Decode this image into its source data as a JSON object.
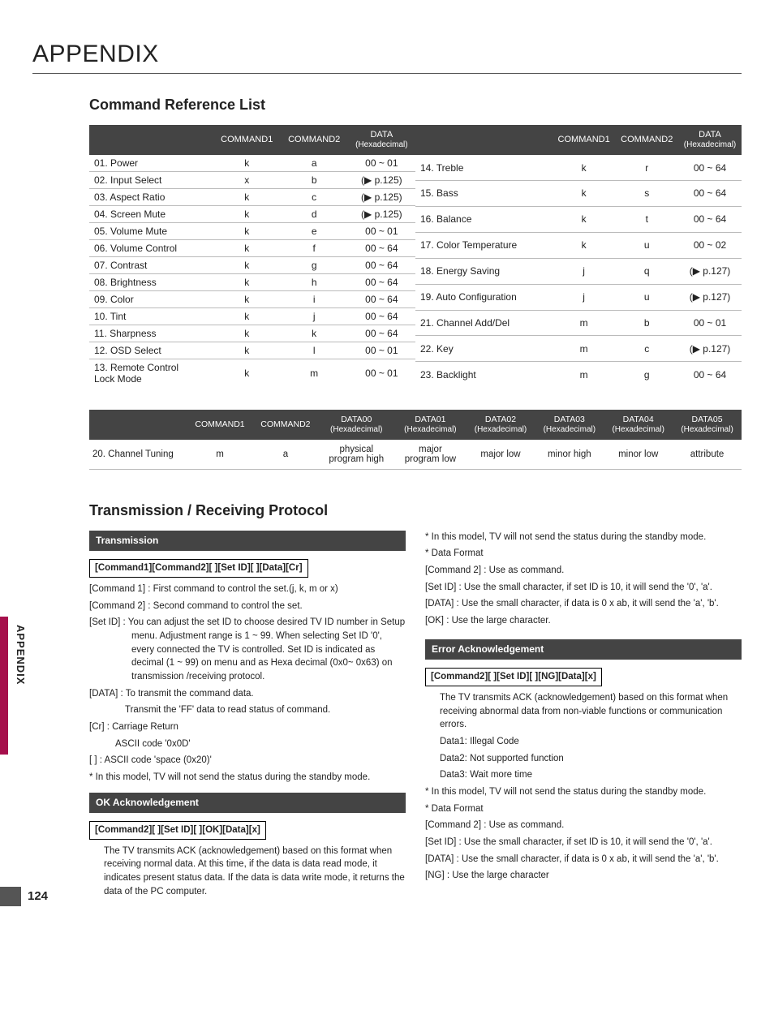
{
  "page": {
    "title": "APPENDIX",
    "side_label": "APPENDIX",
    "number": "124"
  },
  "section1": {
    "title": "Command Reference List"
  },
  "headers": {
    "c1": "COMMAND1",
    "c2": "COMMAND2",
    "data": "DATA",
    "hex": "(Hexadecimal)"
  },
  "left_rows": [
    {
      "n": "01. Power",
      "c1": "k",
      "c2": "a",
      "d": "00 ~ 01"
    },
    {
      "n": "02. Input Select",
      "c1": "x",
      "c2": "b",
      "d": "(▶ p.125)"
    },
    {
      "n": "03. Aspect Ratio",
      "c1": "k",
      "c2": "c",
      "d": "(▶ p.125)"
    },
    {
      "n": "04. Screen Mute",
      "c1": "k",
      "c2": "d",
      "d": "(▶ p.125)"
    },
    {
      "n": "05. Volume Mute",
      "c1": "k",
      "c2": "e",
      "d": "00 ~ 01"
    },
    {
      "n": "06. Volume Control",
      "c1": "k",
      "c2": "f",
      "d": "00 ~ 64"
    },
    {
      "n": "07. Contrast",
      "c1": "k",
      "c2": "g",
      "d": "00 ~ 64"
    },
    {
      "n": "08. Brightness",
      "c1": "k",
      "c2": "h",
      "d": "00 ~ 64"
    },
    {
      "n": "09. Color",
      "c1": "k",
      "c2": "i",
      "d": "00 ~ 64"
    },
    {
      "n": "10.  Tint",
      "c1": "k",
      "c2": "j",
      "d": "00 ~ 64"
    },
    {
      "n": "11.  Sharpness",
      "c1": "k",
      "c2": "k",
      "d": "00 ~ 64"
    },
    {
      "n": "12.  OSD Select",
      "c1": "k",
      "c2": "l",
      "d": "00 ~ 01"
    },
    {
      "n": "13. Remote Control\n       Lock Mode",
      "c1": "k",
      "c2": "m",
      "d": "00 ~ 01"
    }
  ],
  "right_rows": [
    {
      "n": "14.  Treble",
      "c1": "k",
      "c2": "r",
      "d": "00 ~ 64"
    },
    {
      "n": "15.  Bass",
      "c1": "k",
      "c2": "s",
      "d": "00 ~ 64"
    },
    {
      "n": "16.  Balance",
      "c1": "k",
      "c2": "t",
      "d": "00 ~ 64"
    },
    {
      "n": "17.  Color Temperature",
      "c1": "k",
      "c2": "u",
      "d": "00 ~ 02"
    },
    {
      "n": "18. Energy Saving",
      "c1": "j",
      "c2": "q",
      "d": "(▶ p.127)"
    },
    {
      "n": "19. Auto Configuration",
      "c1": "j",
      "c2": "u",
      "d": "(▶ p.127)"
    },
    {
      "n": "21. Channel Add/Del",
      "c1": "m",
      "c2": "b",
      "d": "00 ~ 01"
    },
    {
      "n": "22. Key",
      "c1": "m",
      "c2": "c",
      "d": "(▶ p.127)"
    },
    {
      "n": "23. Backlight",
      "c1": "m",
      "c2": "g",
      "d": "00 ~ 64"
    }
  ],
  "tuning": {
    "headers": {
      "c1": "COMMAND1",
      "c2": "COMMAND2",
      "d0": "DATA00",
      "d1": "DATA01",
      "d2": "DATA02",
      "d3": "DATA03",
      "d4": "DATA04",
      "d5": "DATA05",
      "hex": "(Hexadecimal)"
    },
    "row": {
      "n": "20. Channel Tuning",
      "c1": "m",
      "c2": "a",
      "d0": "physical\nprogram high",
      "d1": "major\nprogram low",
      "d2": "major low",
      "d3": "minor high",
      "d4": "minor low",
      "d5": "attribute"
    }
  },
  "section2": {
    "title": "Transmission / Receiving  Protocol"
  },
  "proto": {
    "tx_header": "Transmission",
    "tx_format": "[Command1][Command2][  ][Set ID][  ][Data][Cr]",
    "tx_lines": [
      "[Command 1] : First command to control the set.(j, k, m or x)",
      "[Command 2] : Second command to control the set."
    ],
    "setid_label": "[Set ID] :",
    "setid_body": "You can adjust the set ID to choose desired TV ID number in Setup menu. Adjustment range is 1 ~ 99. When selecting Set ID '0', every connected the TV is controlled. Set ID is indicated as decimal (1 ~ 99) on menu and as Hexa decimal (0x0~ 0x63) on transmission /receiving protocol.",
    "data_label": "[DATA] : To transmit the command data.",
    "data_sub": "Transmit the 'FF' data to read status of command.",
    "cr_label": "[Cr] : Carriage Return",
    "cr_sub": "ASCII code '0x0D'",
    "space_line": "[   ] : ASCII code 'space (0x20)'",
    "tx_note": "* In this model, TV will not send the status during the standby mode.",
    "ok_header": "OK Acknowledgement",
    "ok_format": "[Command2][  ][Set ID][  ][OK][Data][x]",
    "ok_body": "The TV transmits ACK (acknowledgement) based on this format when receiving normal data. At this time, if the data is data read mode, it indicates present status data. If the data is data write mode, it returns the data of the PC computer.",
    "r_note1": "* In this model, TV will not send the status during the standby mode.",
    "r_note2": "* Data Format",
    "r_lines": [
      "[Command 2] : Use as command.",
      "[Set ID] : Use the small character, if set ID is 10, it will send the '0', 'a'.",
      "[DATA] : Use the small character, if data is 0 x ab, it will send the 'a', 'b'.",
      "[OK] : Use the large character."
    ],
    "err_header": "Error Acknowledgement",
    "err_format": "[Command2][  ][Set ID][  ][NG][Data][x]",
    "err_body": "The TV transmits ACK (acknowledgement) based on this format when receiving abnormal data from non-viable functions or communication errors.",
    "err_data": [
      "Data1: Illegal Code",
      "Data2: Not supported function",
      "Data3: Wait more time"
    ],
    "err_note1": "* In this model, TV will not send the status during the standby mode.",
    "err_note2": "* Data Format",
    "err_lines": [
      "[Command 2] : Use as command.",
      "[Set ID] : Use the small character, if set ID is 10, it will send the '0', 'a'.",
      "[DATA] : Use the small character, if data is 0 x ab, it will send the 'a', 'b'.",
      "[NG] : Use the large character"
    ]
  }
}
